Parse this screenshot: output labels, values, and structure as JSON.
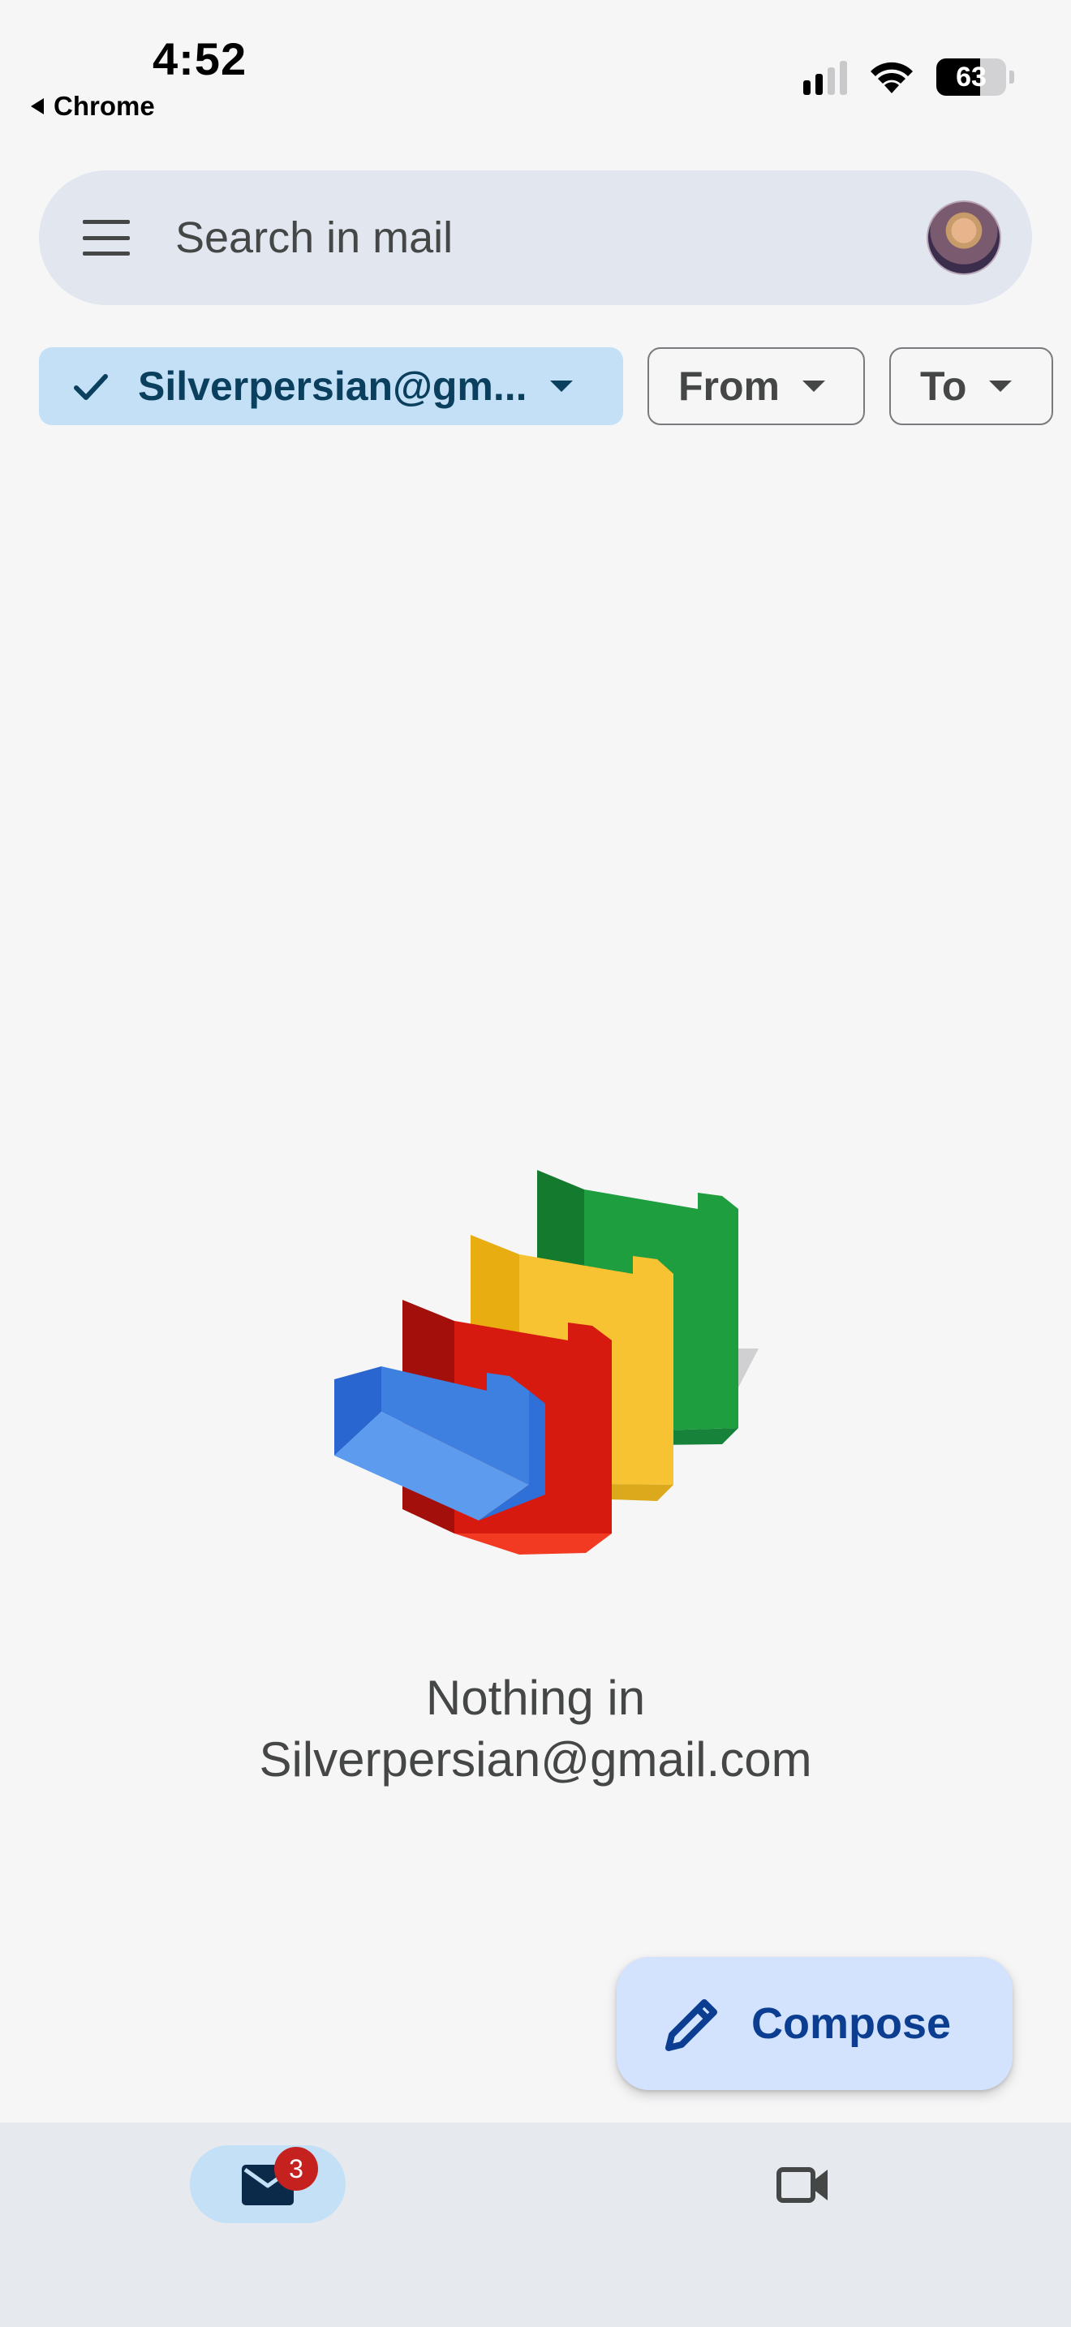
{
  "status_bar": {
    "time": "4:52",
    "back_app": "Chrome",
    "battery": "63",
    "battery_level": 0.63
  },
  "search": {
    "placeholder": "Search in mail",
    "menu_icon": "hamburger-menu-icon",
    "avatar_icon": "account-avatar"
  },
  "filters": {
    "account_chip": "Silverpersian@gm...",
    "from_chip": "From",
    "to_chip": "To"
  },
  "empty_state": {
    "line1": "Nothing in",
    "line2": "Silverpersian@gmail.com",
    "illustration": "empty-folders-illustration"
  },
  "compose": {
    "label": "Compose",
    "icon": "pencil-icon"
  },
  "bottom_nav": {
    "mail_badge": "3",
    "mail_icon": "mail-icon",
    "meet_icon": "video-camera-icon"
  },
  "colors": {
    "background": "#f6f6f7",
    "search_bar": "#e1e6ef",
    "chip_selected": "#c3e0f6",
    "compose_bg": "#d3e3fd",
    "compose_text": "#0b3d91",
    "badge": "#c5221f",
    "folder_green": "#1e9e3e",
    "folder_yellow": "#f7c332",
    "folder_red": "#d61a0f",
    "folder_blue": "#3d80e0"
  }
}
